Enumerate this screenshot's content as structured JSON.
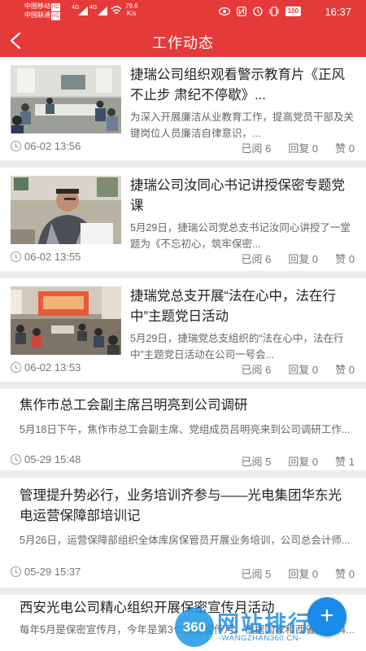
{
  "status_bar": {
    "carrier1": "中国移动",
    "carrier2": "中国联通",
    "hd": "HD",
    "net1": "4G",
    "net2": "4G",
    "speed_value": "79.6",
    "speed_unit": "K/s",
    "battery": "100",
    "time": "16:37"
  },
  "header": {
    "title": "工作动态"
  },
  "articles": [
    {
      "title": "捷瑞公司组织观看警示教育片《正风不止步 肃纪不停歇》...",
      "summary": "为深入开展廉洁从业教育工作，提高党员干部及关键岗位人员廉洁自律意识，...",
      "time": "06-02 13:56",
      "read": "已阅 6",
      "reply": "回复 0",
      "like": "赞 0"
    },
    {
      "title": "捷瑞公司汝同心书记讲授保密专题党课",
      "summary": "5月29日，捷瑞公司党总支书记汝同心讲授了一堂题为《不忘初心，筑牢保密...",
      "time": "06-02 13:55",
      "read": "已阅 6",
      "reply": "回复 0",
      "like": "赞 0"
    },
    {
      "title": "捷瑞党总支开展“法在心中，法在行中”主题党日活动",
      "summary": "5月29日，捷瑞党总支组织的“法在心中，法在行中”主题党日活动在公司一号会...",
      "time": "06-02 13:53",
      "read": "已阅 6",
      "reply": "回复 0",
      "like": "赞 0"
    },
    {
      "title": "焦作市总工会副主席吕明亮到公司调研",
      "summary": "5月18日下午，焦作市总工会副主席、党组成员吕明亮来到公司调研工作...",
      "time": "05-29 15:48",
      "read": "已阅 5",
      "reply": "回复 0",
      "like": "赞 1"
    },
    {
      "title": "管理提升势必行，业务培训齐参与——光电集团华东光电运营保障部培训记",
      "summary": "5月26日，运营保障部组织全体库房保管员开展业务培训，公司总会计师...",
      "time": "05-29 15:37",
      "read": "已阅 5",
      "reply": "回复 0",
      "like": "赞 0"
    },
    {
      "title": "西安光电公司精心组织开展保密宣传月活动",
      "summary": "每年5月是保密宣传月，今年是第3个保密宣传月，根据国家和西省国防科..."
    }
  ],
  "fab": {
    "label": "+"
  },
  "watermark": {
    "badge": "360",
    "name": "网站排行榜",
    "url": "-WANGZHAN360.CN-"
  },
  "colors": {
    "brand_red": "#e43a3a",
    "fab_blue": "#1a8be8"
  }
}
